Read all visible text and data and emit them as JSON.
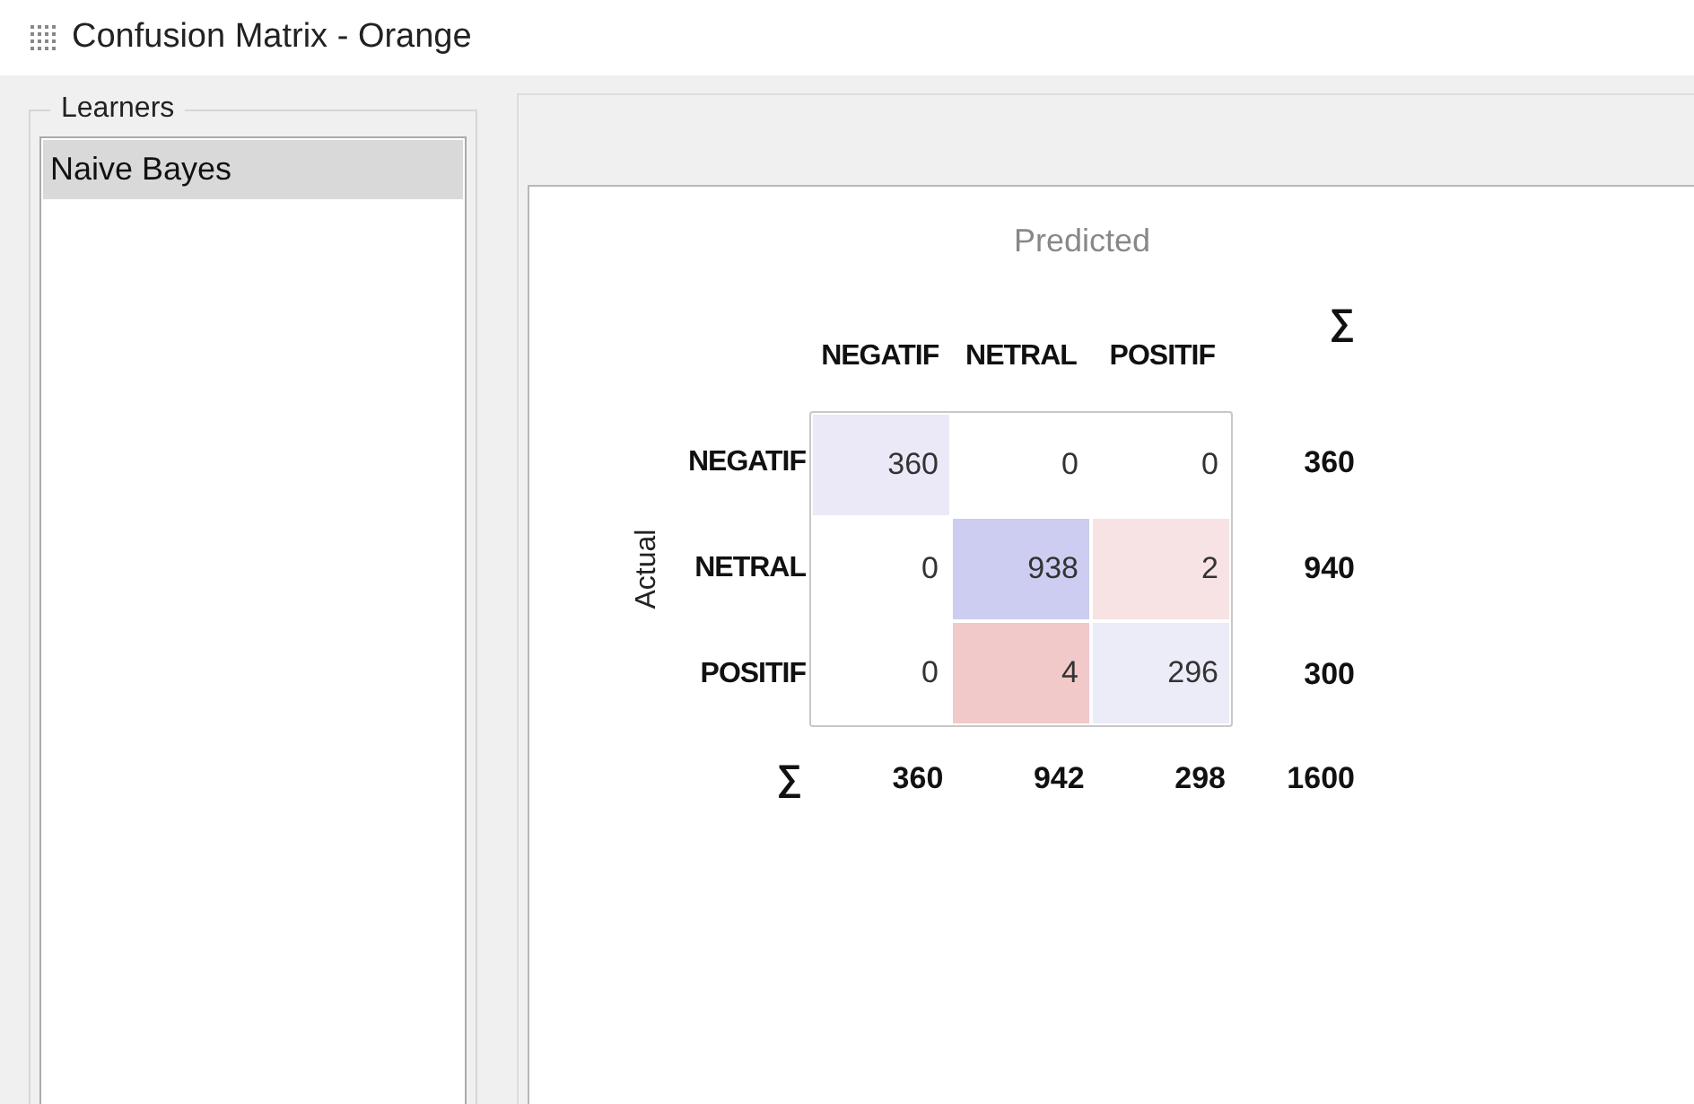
{
  "window": {
    "title": "Confusion Matrix - Orange"
  },
  "learners": {
    "title": "Learners",
    "items": [
      {
        "label": "Naive Bayes",
        "selected": true
      }
    ]
  },
  "matrix": {
    "predicted_label": "Predicted",
    "actual_label": "Actual",
    "columns": [
      "NEGATIF",
      "NETRAL",
      "POSITIF"
    ],
    "sum_header": "∑",
    "rows": [
      {
        "label": "NEGATIF",
        "cells": [
          {
            "value": "360",
            "color": "#ebe9f8"
          },
          {
            "value": "0",
            "color": "#ffffff"
          },
          {
            "value": "0",
            "color": "#ffffff"
          }
        ],
        "total": "360"
      },
      {
        "label": "NETRAL",
        "cells": [
          {
            "value": "0",
            "color": "#ffffff"
          },
          {
            "value": "938",
            "color": "#cccdf0"
          },
          {
            "value": "2",
            "color": "#f7e3e3"
          }
        ],
        "total": "940"
      },
      {
        "label": "POSITIF",
        "cells": [
          {
            "value": "0",
            "color": "#ffffff"
          },
          {
            "value": "4",
            "color": "#f2c9c9"
          },
          {
            "value": "296",
            "color": "#ecebf8"
          }
        ],
        "total": "300"
      }
    ],
    "sum_row_label": "∑",
    "column_totals": [
      "360",
      "942",
      "298"
    ],
    "grand_total": "1600"
  }
}
